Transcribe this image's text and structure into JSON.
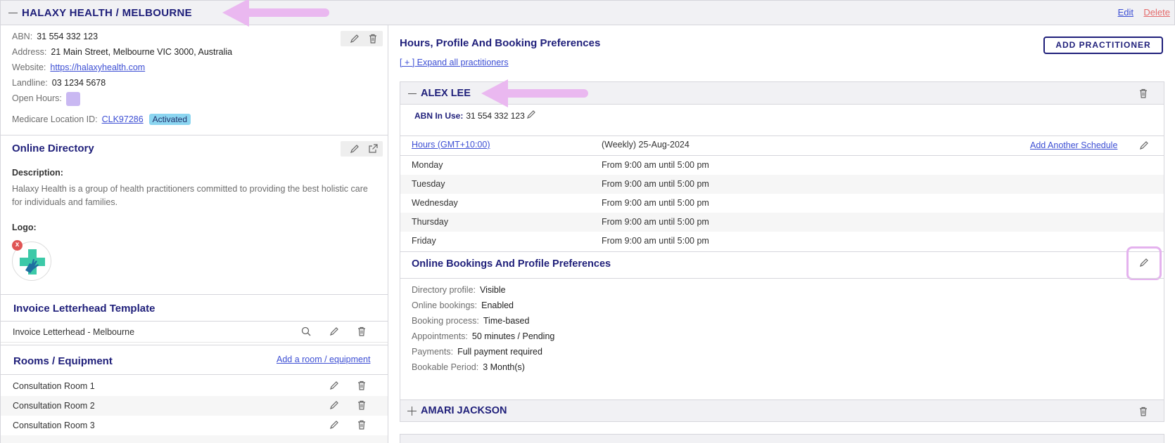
{
  "header": {
    "title": "HALAXY HEALTH / MELBOURNE",
    "edit_label": "Edit",
    "delete_label": "Delete"
  },
  "location": {
    "abn_label": "ABN:",
    "abn": "31 554 332 123",
    "address_label": "Address:",
    "address": "21 Main Street, Melbourne VIC 3000, Australia",
    "website_label": "Website:",
    "website": "https://halaxyhealth.com",
    "landline_label": "Landline:",
    "landline": "03 1234 5678",
    "open_hours_label": "Open Hours:",
    "medicare_label": "Medicare Location ID:",
    "medicare_id": "CLK97286",
    "medicare_status": "Activated"
  },
  "directory": {
    "title": "Online Directory",
    "description_label": "Description:",
    "description": "Halaxy Health is a group of health practitioners committed to providing the best holistic care for individuals and families.",
    "logo_label": "Logo:",
    "logo_remove": "x"
  },
  "letterhead": {
    "title": "Invoice Letterhead Template",
    "item": "Invoice Letterhead - Melbourne"
  },
  "rooms": {
    "title": "Rooms / Equipment",
    "add_label": "Add a room / equipment",
    "items": [
      "Consultation Room 1",
      "Consultation Room 2",
      "Consultation Room 3"
    ]
  },
  "main": {
    "title": "Hours, Profile And Booking Preferences",
    "add_practitioner": "ADD PRACTITIONER",
    "expand_all": "[ + ] Expand all practitioners"
  },
  "practitioner": {
    "name": "ALEX LEE",
    "abn_label": "ABN In Use:",
    "abn": "31 554 332 123",
    "hours_link": "Hours (GMT+10:00)",
    "schedule": "(Weekly) 25-Aug-2024",
    "add_schedule": "Add Another Schedule",
    "hours": [
      {
        "day": "Monday",
        "time": "From 9:00 am until 5:00 pm"
      },
      {
        "day": "Tuesday",
        "time": "From 9:00 am until 5:00 pm"
      },
      {
        "day": "Wednesday",
        "time": "From 9:00 am until 5:00 pm"
      },
      {
        "day": "Thursday",
        "time": "From 9:00 am until 5:00 pm"
      },
      {
        "day": "Friday",
        "time": "From 9:00 am until 5:00 pm"
      }
    ],
    "prefs_title": "Online Bookings And Profile Preferences",
    "prefs": [
      {
        "label": "Directory profile:",
        "value": "Visible"
      },
      {
        "label": "Online bookings:",
        "value": "Enabled"
      },
      {
        "label": "Booking process:",
        "value": "Time-based"
      },
      {
        "label": "Appointments:",
        "value": "50 minutes / Pending"
      },
      {
        "label": "Payments:",
        "value": "Full payment required"
      },
      {
        "label": "Bookable Period:",
        "value": "3 Month(s)"
      }
    ]
  },
  "practitioner2": {
    "name": "AMARI JACKSON"
  },
  "colors": {
    "navy": "#1f1f7a",
    "link": "#3d4fd4",
    "delete": "#e46a6a",
    "annotation": "#eab8f0",
    "badge": "#8bd5f0"
  }
}
